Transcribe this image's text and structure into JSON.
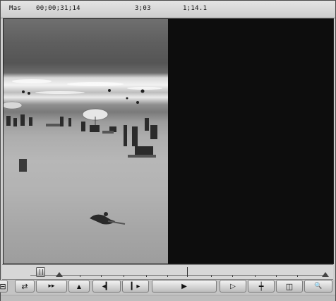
{
  "header": {
    "mode_label": "Mas",
    "timecode": "00;00;31;14",
    "duration": "3;03",
    "ratio": "1;14.1"
  },
  "controls": {
    "buttons": [
      {
        "name": "clip-button",
        "icon": "square-bracket-icon",
        "glyph": "⊟"
      },
      {
        "name": "swap-button",
        "icon": "swap-arrows-icon",
        "glyph": "⇄"
      },
      {
        "name": "fast-forward-button",
        "icon": "fast-forward-icon",
        "glyph": "▸▸"
      },
      {
        "name": "mark-button",
        "icon": "triangle-up-icon",
        "glyph": "▲"
      },
      {
        "name": "step-back-button",
        "icon": "step-back-icon",
        "glyph": "◂▎"
      },
      {
        "name": "step-forward-button",
        "icon": "step-forward-icon",
        "glyph": "▎▸"
      },
      {
        "name": "play-button",
        "icon": "play-icon",
        "glyph": "▶"
      },
      {
        "name": "play-outline-button",
        "icon": "play-outline-icon",
        "glyph": "▷"
      },
      {
        "name": "mark-clip-button",
        "icon": "marker-icon",
        "glyph": "┿"
      },
      {
        "name": "split-view-button",
        "icon": "split-view-icon",
        "glyph": "◫"
      },
      {
        "name": "zoom-button",
        "icon": "magnifier-icon",
        "glyph": "🔍"
      }
    ]
  }
}
